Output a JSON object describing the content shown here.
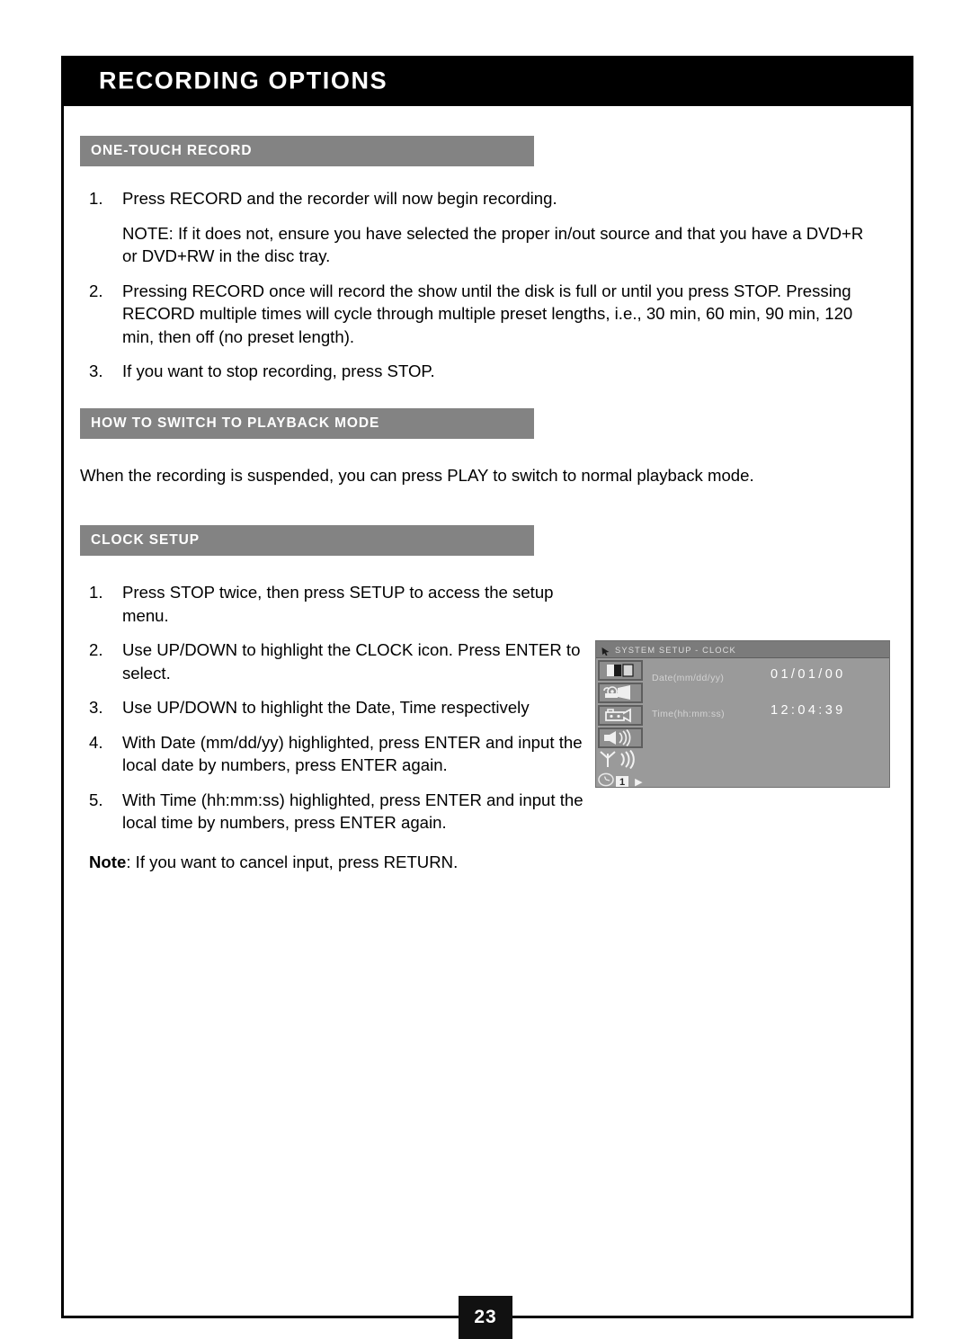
{
  "header": {
    "title": "RECORDING OPTIONS"
  },
  "sections": [
    {
      "heading": "ONE-TOUCH RECORD",
      "items": [
        {
          "num": "1.",
          "text": "Press RECORD and the recorder will now begin recording."
        },
        {
          "num": "",
          "text": "NOTE: If it does not, ensure you have selected the proper in/out source and that you have a DVD+R or DVD+RW in the disc tray."
        },
        {
          "num": "2.",
          "text": "Pressing RECORD once will record the show until the disk is full or until you press STOP. Pressing RECORD multiple times will cycle through multiple preset lengths, i.e., 30 min, 60 min, 90 min, 120 min, then off (no preset length)."
        },
        {
          "num": "3.",
          "text": "If you want to stop recording, press STOP."
        }
      ]
    },
    {
      "heading": "HOW TO SWITCH TO PLAYBACK MODE",
      "paragraph": "When the recording is suspended, you can press PLAY to switch to normal playback mode."
    },
    {
      "heading": "CLOCK SETUP",
      "items": [
        {
          "num": "1.",
          "text": "Press STOP twice, then press SETUP to access the setup menu."
        },
        {
          "num": "2.",
          "text": "Use UP/DOWN  to highlight the CLOCK icon. Press ENTER to select."
        },
        {
          "num": "3.",
          "text": "Use UP/DOWN to highlight the Date, Time respectively"
        },
        {
          "num": "4.",
          "text": "With  Date (mm/dd/yy) highlighted, press ENTER and input the local date by numbers, press ENTER again."
        },
        {
          "num": "5.",
          "text": "With  Time (hh:mm:ss) highlighted, press ENTER and input the local time by numbers, press ENTER again."
        }
      ],
      "note_label": "Note",
      "note_text": ": If you want to cancel input, press RETURN."
    }
  ],
  "osd": {
    "title": "SYSTEM SETUP  -  CLOCK",
    "rows": [
      {
        "label": "Date(mm/dd/yy)",
        "value": "01/01/00"
      },
      {
        "label": "Time(hh:mm:ss)",
        "value": "12:04:39"
      }
    ],
    "icons": [
      "video-display-icon",
      "camcorder-record-icon",
      "camcorder-playback-icon",
      "speaker-audio-icon",
      "antenna-tuner-icon",
      "clock-page-icon"
    ],
    "page_indicator": "1",
    "next_arrow": "▶"
  },
  "footer": {
    "page_number": "23"
  },
  "colors": {
    "header_band": "#000000",
    "section_bar": "#838383",
    "osd_background": "#9a9a9a",
    "osd_titlebar": "#7b7b7b"
  }
}
